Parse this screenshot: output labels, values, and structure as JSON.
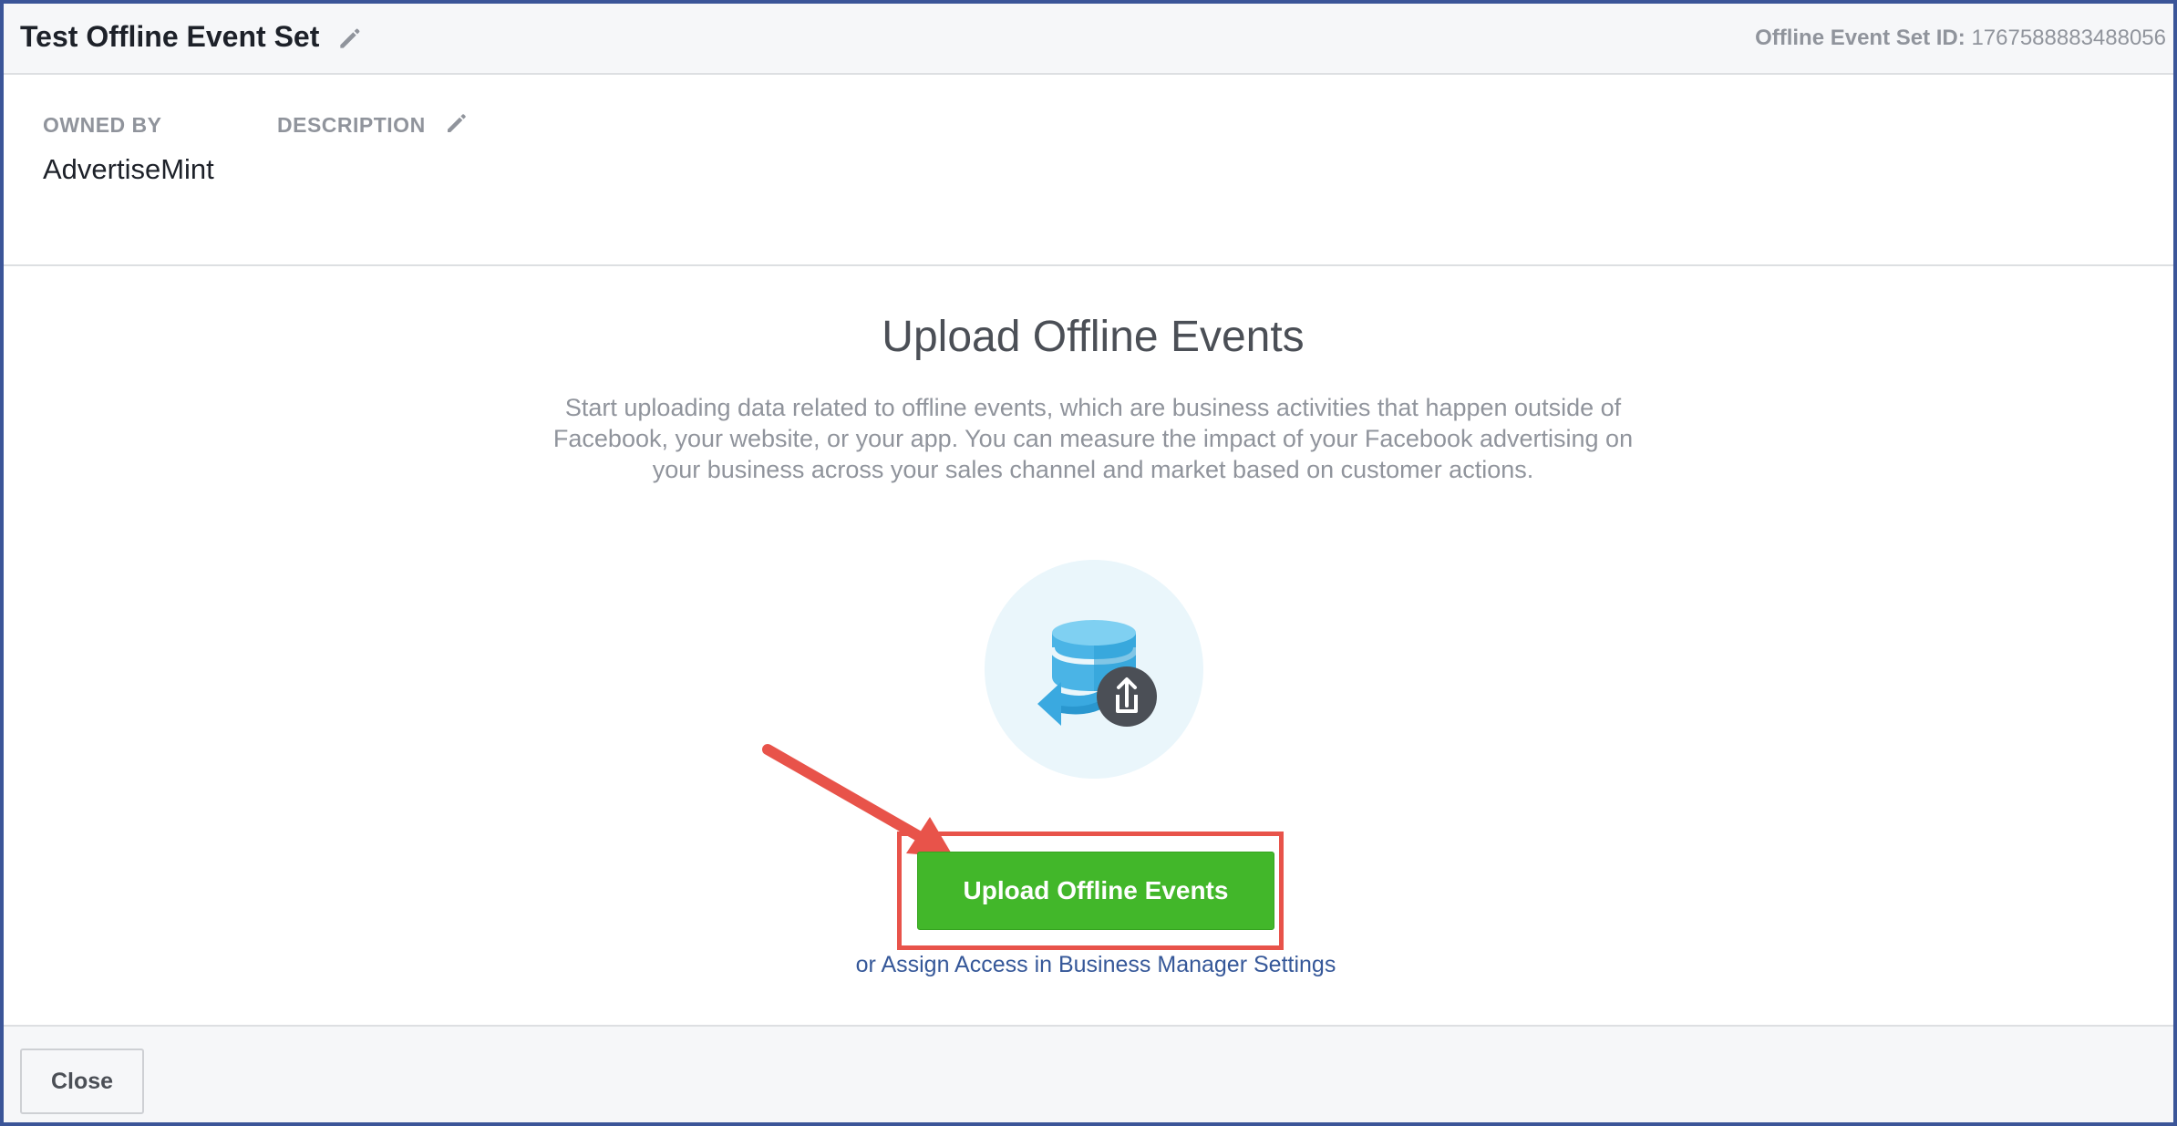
{
  "header": {
    "title": "Test Offline Event Set",
    "id_label": "Offline Event Set ID:",
    "id_value": "1767588883488056",
    "edit_icon": "pencil-icon"
  },
  "meta": {
    "owned_by_label": "OWNED BY",
    "owned_by_value": "AdvertiseMint",
    "description_label": "DESCRIPTION",
    "description_edit_icon": "pencil-icon"
  },
  "main": {
    "heading": "Upload Offline Events",
    "description": "Start uploading data related to offline events, which are business activities that happen outside of Facebook, your website, or your app. You can measure the impact of your Facebook advertising on your business across your sales channel and market based on customer actions.",
    "illustration_icon": "database-upload-icon",
    "upload_button_label": "Upload Offline Events",
    "assign_link": "or Assign Access in Business Manager Settings"
  },
  "annotation": {
    "arrow_icon": "arrow-pointer-icon",
    "color": "#e8534a"
  },
  "footer": {
    "close_label": "Close"
  },
  "colors": {
    "frame_border": "#3b5598",
    "primary_green": "#42b72a",
    "link_blue": "#365899"
  }
}
